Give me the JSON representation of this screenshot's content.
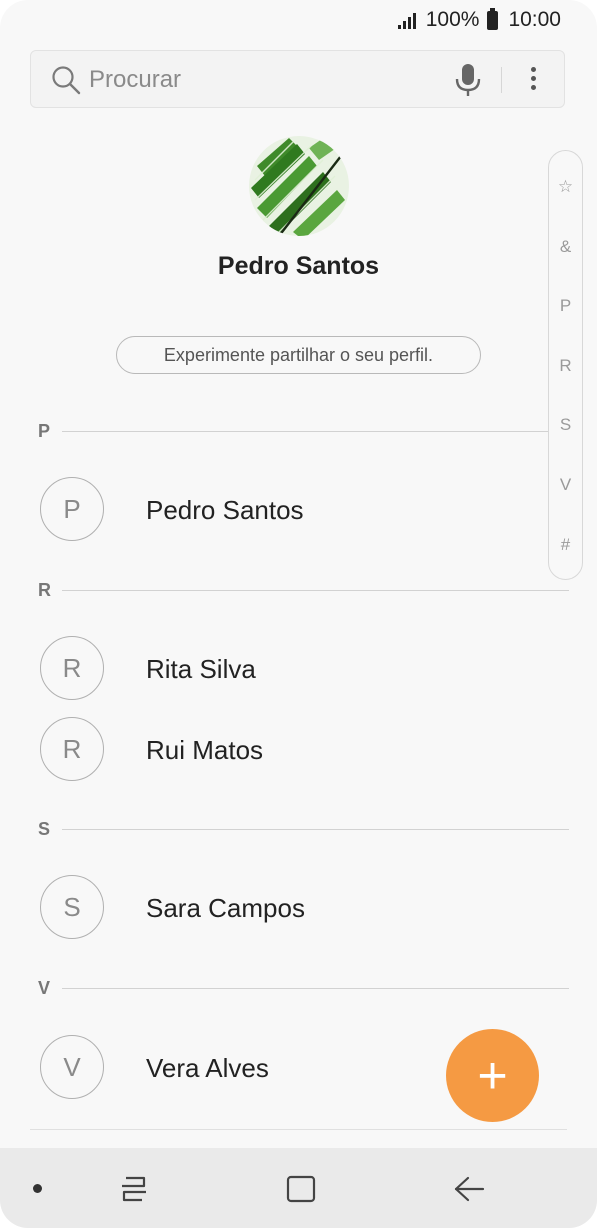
{
  "status_bar": {
    "battery": "100%",
    "time": "10:00"
  },
  "search": {
    "placeholder": "Procurar"
  },
  "profile": {
    "name": "Pedro Santos",
    "share_prompt": "Experimente partilhar o seu perfil."
  },
  "index": [
    "☆",
    "&",
    "P",
    "R",
    "S",
    "V",
    "#"
  ],
  "sections": [
    {
      "letter": "P",
      "contacts": [
        {
          "initial": "P",
          "name": "Pedro Santos"
        }
      ]
    },
    {
      "letter": "R",
      "contacts": [
        {
          "initial": "R",
          "name": "Rita Silva"
        },
        {
          "initial": "R",
          "name": "Rui Matos"
        }
      ]
    },
    {
      "letter": "S",
      "contacts": [
        {
          "initial": "S",
          "name": "Sara Campos"
        }
      ]
    },
    {
      "letter": "V",
      "contacts": [
        {
          "initial": "V",
          "name": "Vera Alves"
        }
      ]
    }
  ],
  "fab": {
    "symbol": "+"
  },
  "colors": {
    "accent": "#f59a43",
    "background": "#f8f8f8",
    "nav_bar": "#eaeaea"
  }
}
